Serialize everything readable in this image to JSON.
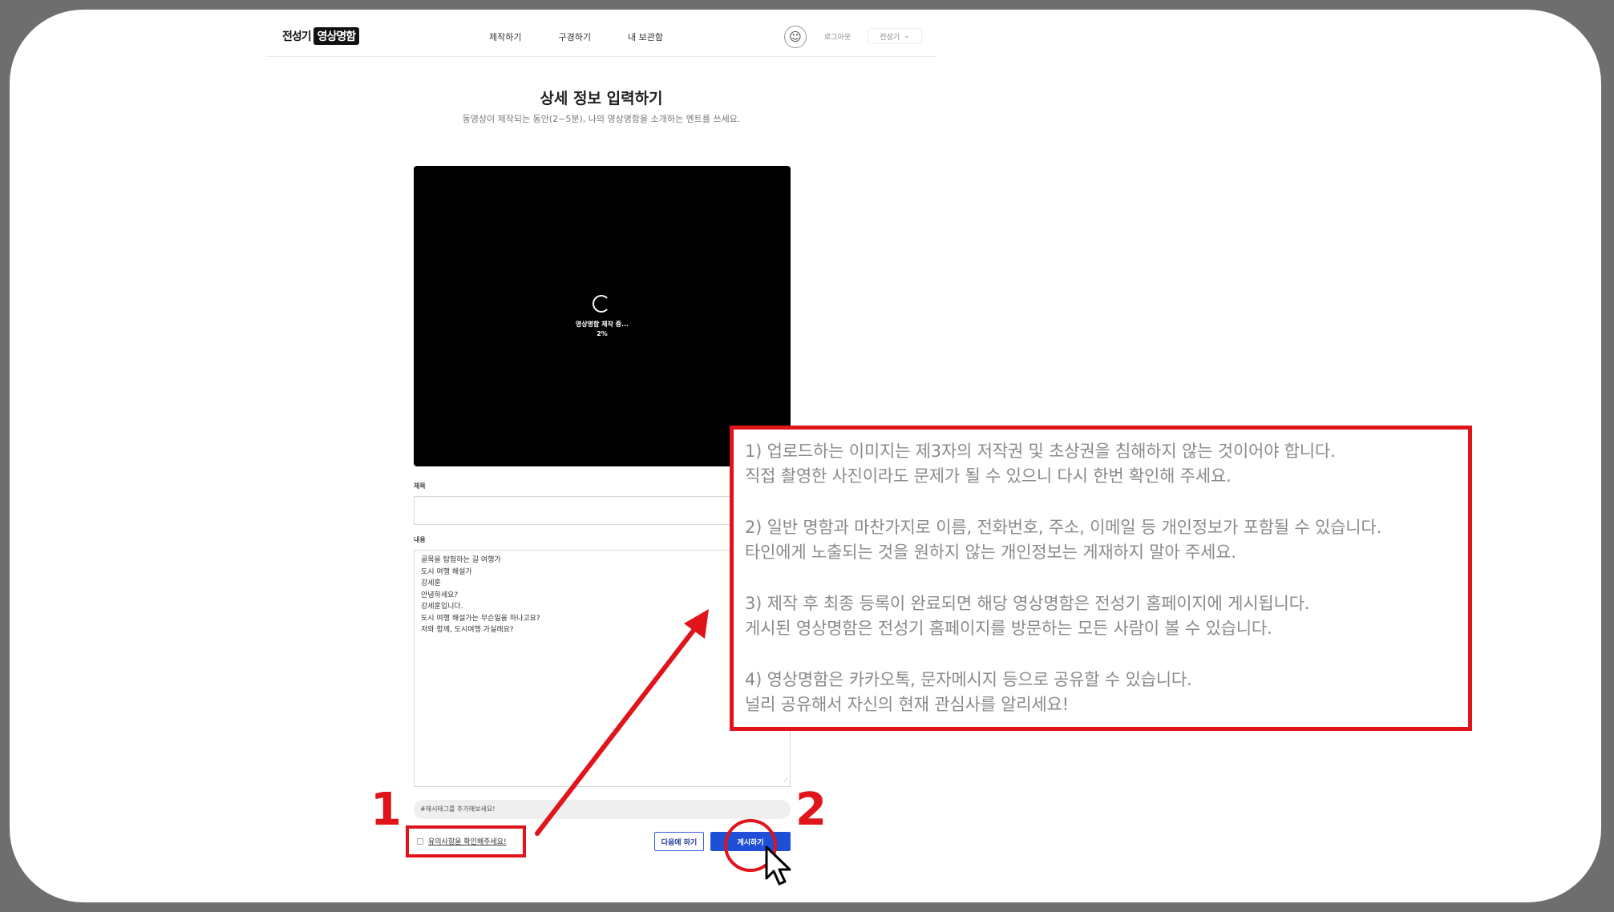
{
  "header": {
    "logo_part1": "전성기",
    "logo_part2": "영상명함",
    "nav": [
      "제작하기",
      "구경하기",
      "내 보관함"
    ],
    "avatar_icon": "smiley-face-icon",
    "logout": "로그아웃",
    "user": "전성기"
  },
  "page": {
    "title": "상세 정보 입력하기",
    "subtitle": "동영상이 제작되는 동안(2~5분), 나의 영상명함을 소개하는 멘트를 쓰세요."
  },
  "video": {
    "status": "영상명함 제작 중...",
    "progress": "2%"
  },
  "form": {
    "title_label": "제목",
    "title_value": "",
    "content_label": "내용",
    "content_lines": [
      "골목을 탐험하는 길 여행가",
      "도시 여행 해설가",
      "강세훈",
      "안녕하세요?",
      "강세훈입니다.",
      "도시 여행 해설가는 무슨일을 하나고요?",
      "저와 함께, 도시여행 가실래요?"
    ],
    "hashtag_placeholder": "#해시태그를 추가해보세요!",
    "notice_check": "유의사항을 확인해주세요!",
    "later_button": "다음에 하기",
    "post_button": "게시하기"
  },
  "annotations": {
    "marker_1": "1",
    "marker_2": "2",
    "accent_color": "#e0141b",
    "callout": {
      "items": [
        [
          "1) 업로드하는 이미지는 제3자의 저작권 및 초상권을 침해하지 않는 것이어야 합니다.",
          "직접 촬영한 사진이라도 문제가 될 수 있으니 다시 한번 확인해 주세요."
        ],
        [
          "2) 일반 명함과 마찬가지로 이름, 전화번호, 주소, 이메일 등 개인정보가 포함될 수 있습니다.",
          "타인에게 노출되는 것을 원하지 않는 개인정보는 게재하지 말아 주세요."
        ],
        [
          "3) 제작 후 최종 등록이 완료되면 해당 영상명함은 전성기 홈페이지에 게시됩니다.",
          "게시된 영상명함은 전성기 홈페이지를 방문하는 모든 사람이 볼 수 있습니다."
        ],
        [
          "4) 영상명함은 카카오톡, 문자메시지 등으로 공유할 수 있습니다.",
          "널리 공유해서 자신의 현재 관심사를 알리세요!"
        ]
      ]
    }
  }
}
